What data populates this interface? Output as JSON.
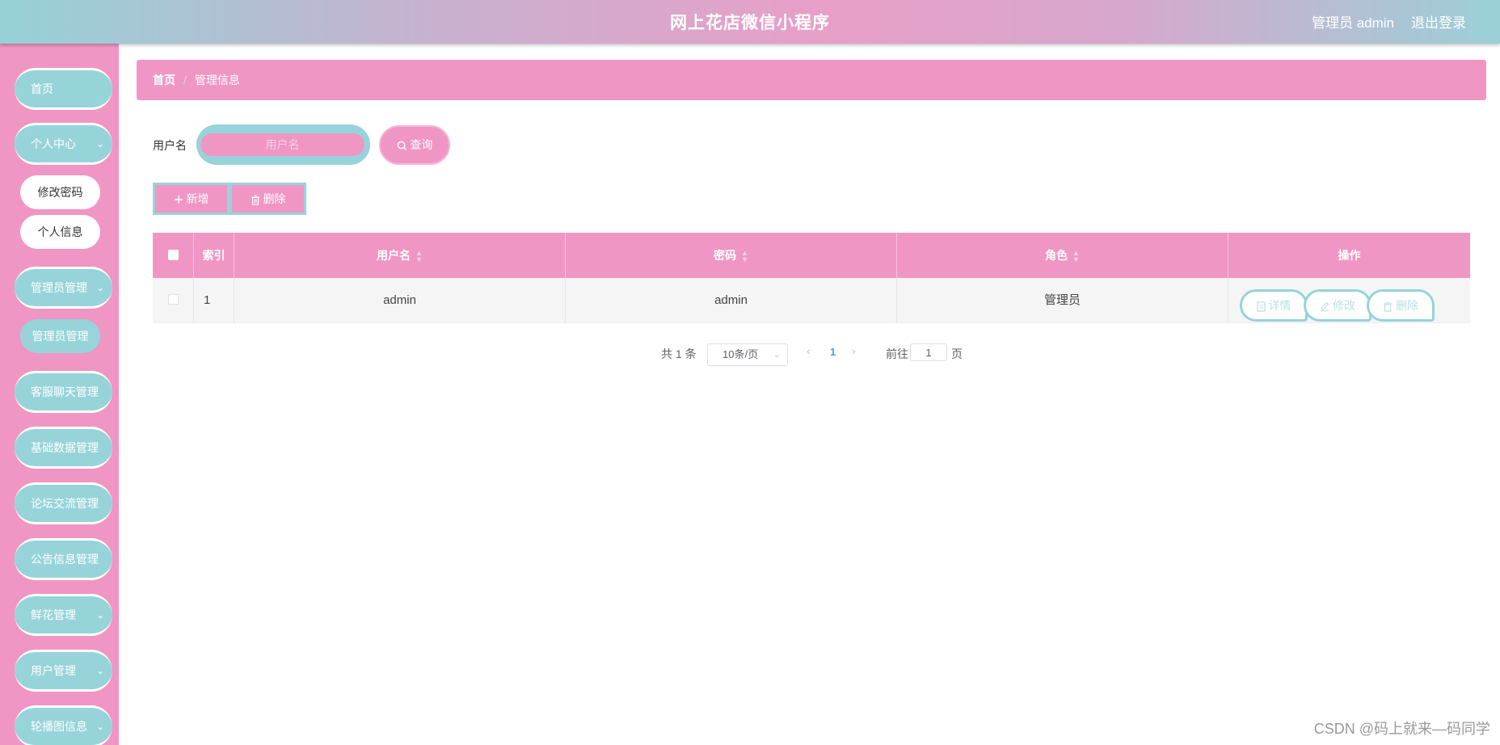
{
  "header": {
    "title": "网上花店微信小程序",
    "user": "管理员 admin",
    "logout": "退出登录"
  },
  "sidebar": {
    "items": [
      {
        "label": "首页"
      },
      {
        "label": "个人中心"
      },
      {
        "label": "管理员管理"
      },
      {
        "label": "客服聊天管理"
      },
      {
        "label": "基础数据管理"
      },
      {
        "label": "论坛交流管理"
      },
      {
        "label": "公告信息管理"
      },
      {
        "label": "鲜花管理"
      },
      {
        "label": "用户管理"
      },
      {
        "label": "轮播图信息"
      }
    ],
    "personal_sub": [
      "修改密码",
      "个人信息"
    ],
    "admin_sub": [
      "管理员管理"
    ]
  },
  "breadcrumb": {
    "home": "首页",
    "separator": "/",
    "current": "管理信息"
  },
  "search": {
    "label": "用户名",
    "placeholder": "用户名",
    "button": "查询"
  },
  "actions": {
    "add": "新增",
    "delete": "删除"
  },
  "table": {
    "headers": {
      "index": "索引",
      "username": "用户名",
      "password": "密码",
      "role": "角色",
      "ops": "操作"
    },
    "rows": [
      {
        "index": "1",
        "username": "admin",
        "password": "admin",
        "role": "管理员"
      }
    ],
    "row_ops": {
      "detail": "详情",
      "edit": "修改",
      "delete": "删除"
    }
  },
  "pagination": {
    "total": "共 1 条",
    "page_size": "10条/页",
    "current": "1",
    "goto_label": "前往",
    "goto_value": "1",
    "page_suffix": "页"
  },
  "watermark": "CSDN @码上就来—码同学",
  "colors": {
    "pink": "#f096c5",
    "teal": "#97d4da"
  }
}
